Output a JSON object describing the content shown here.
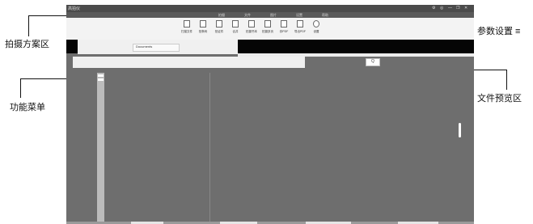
{
  "callouts": {
    "capture_area": "拍摄方案区",
    "params": "参数设置",
    "menu": "功能菜单",
    "preview": "文件预览区"
  },
  "window": {
    "title": "高拍仪",
    "controls": [
      "⚙",
      "◎",
      "—",
      "❐",
      "✕"
    ]
  },
  "tabs": [
    "拍摄",
    "文件",
    "图片",
    "设置",
    "帮助"
  ],
  "toolbar": [
    {
      "label": "扫描文件",
      "icon": "scan-doc-icon"
    },
    {
      "label": "拍条码",
      "icon": "barcode-icon"
    },
    {
      "label": "拍证件",
      "icon": "card-icon"
    },
    {
      "label": "合并",
      "icon": "merge-icon"
    },
    {
      "label": "拍摄书本",
      "icon": "book-icon"
    },
    {
      "label": "拍摄多页",
      "icon": "multi-page-icon"
    },
    {
      "label": "存PDF",
      "icon": "pdf-icon"
    },
    {
      "label": "导出PDF",
      "icon": "export-pdf-icon"
    },
    {
      "label": "设置",
      "icon": "settings-icon"
    }
  ],
  "doc_panel": {
    "path": "Documents",
    "btn1": "浏览",
    "btn2": "打开"
  },
  "search": {
    "value": "Q"
  }
}
